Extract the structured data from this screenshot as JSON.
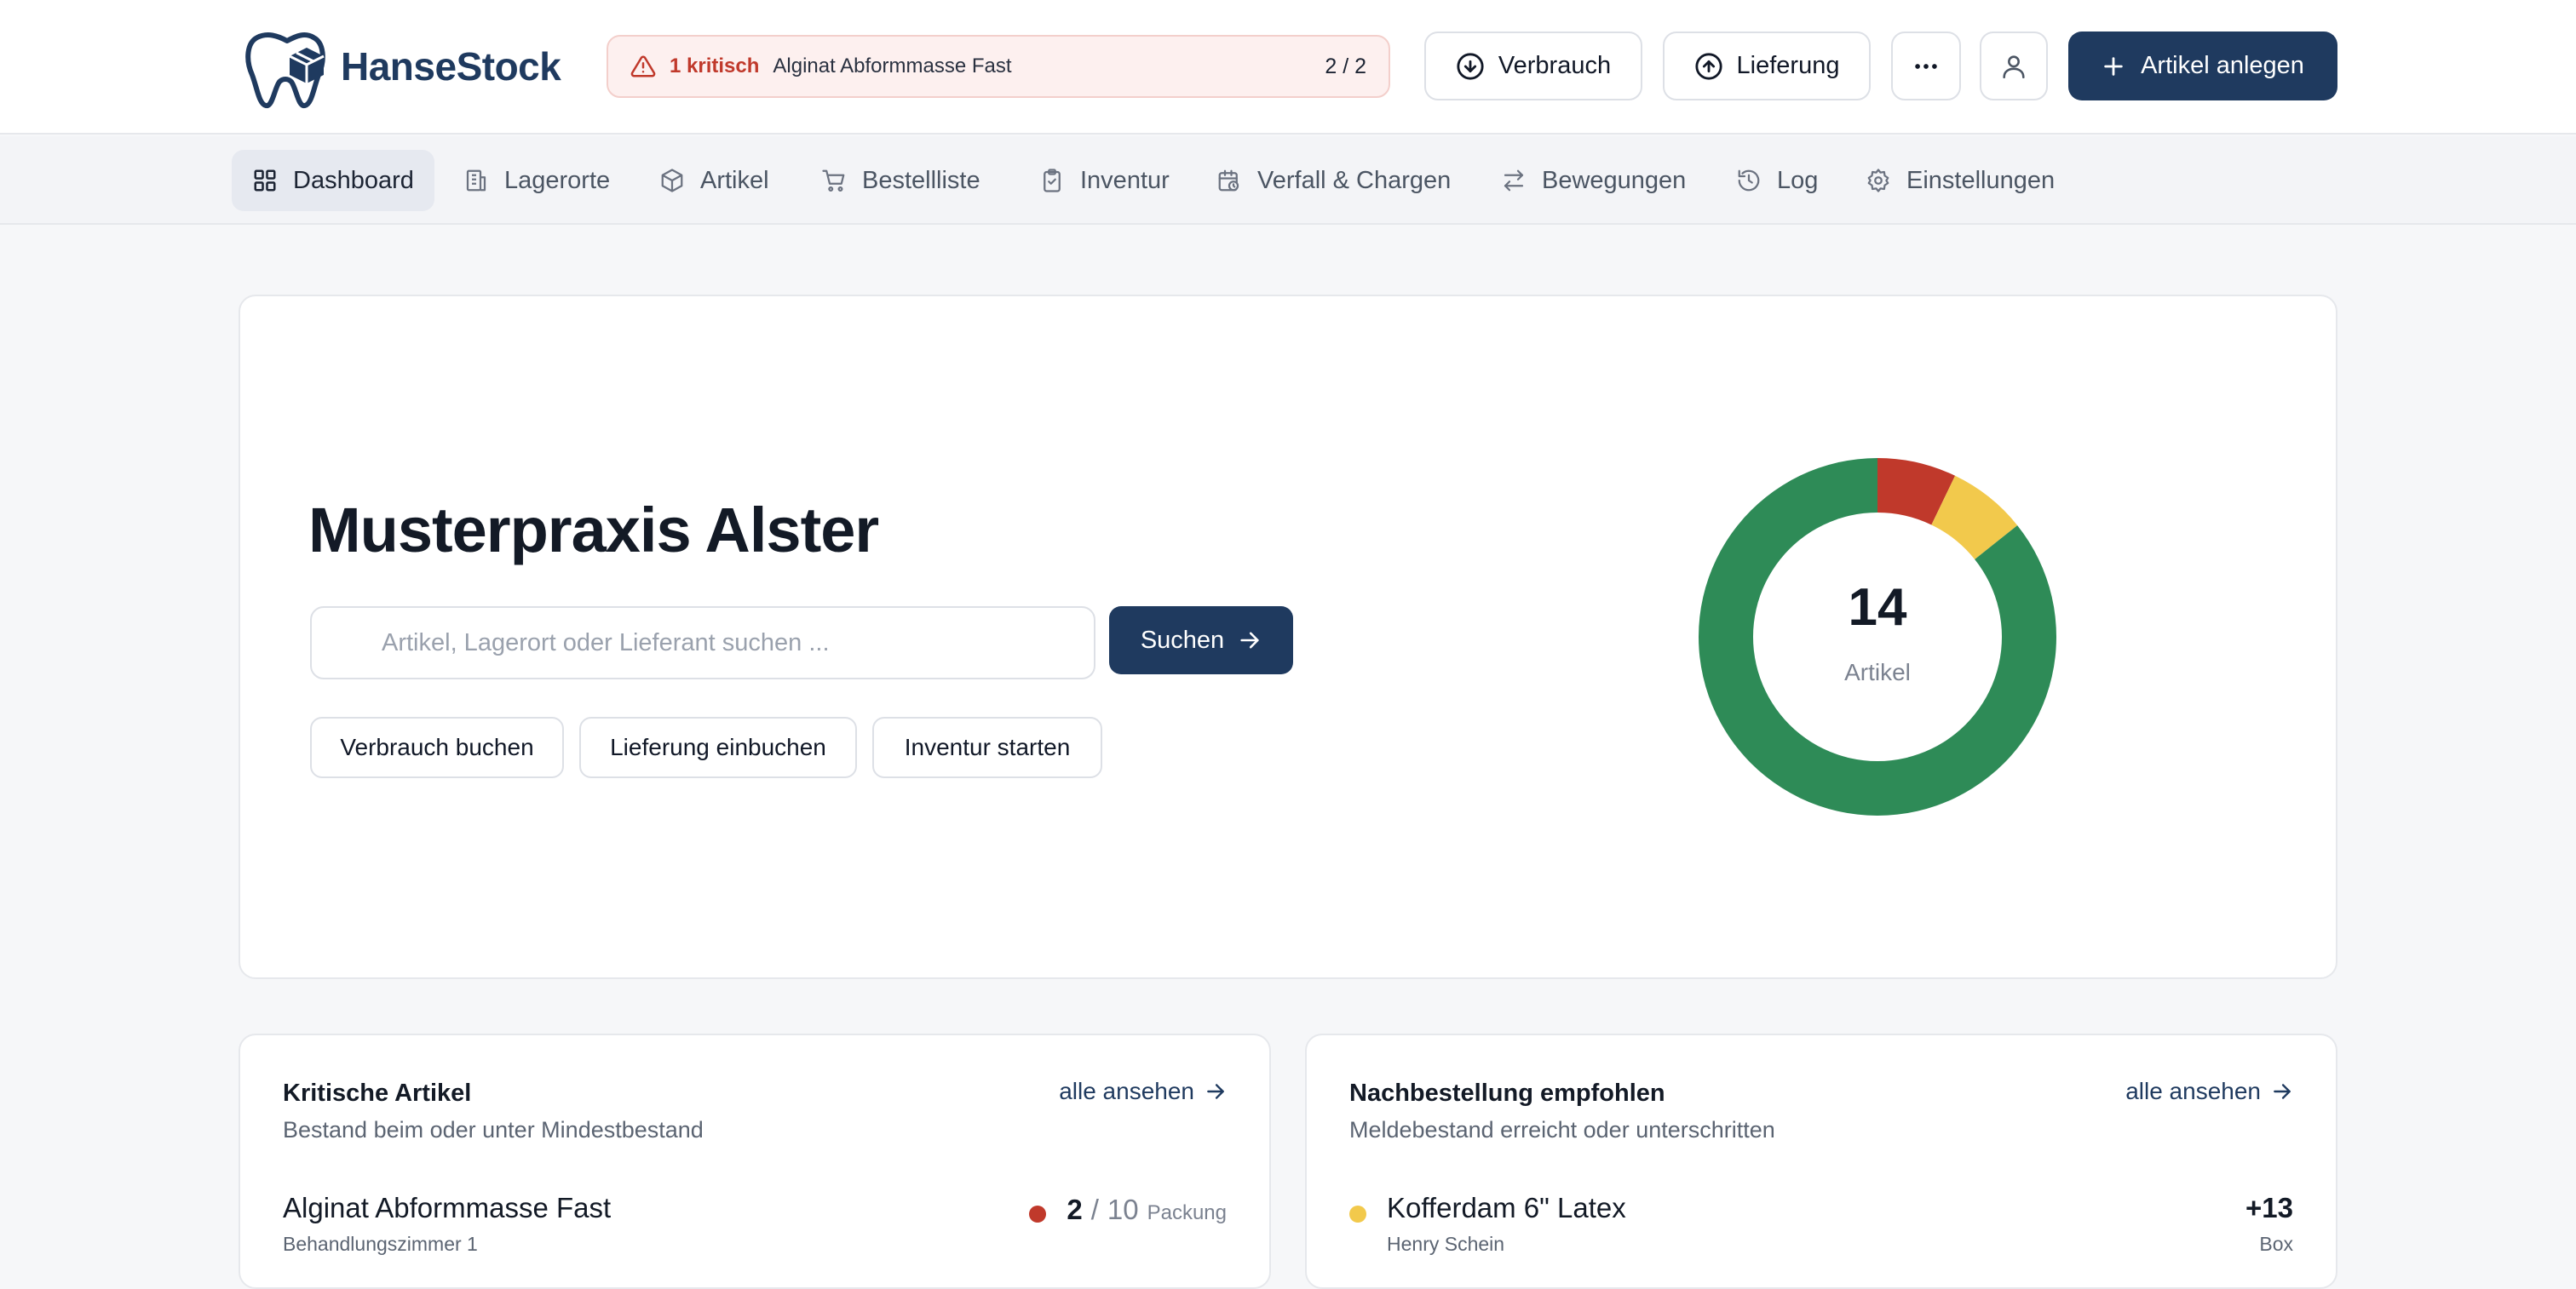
{
  "app": {
    "name": "HanseStock"
  },
  "alert": {
    "critical_label": "1 kritisch",
    "item": "Alginat Abformmasse Fast",
    "counter": "2 / 2"
  },
  "header": {
    "verbrauch_label": "Verbrauch",
    "lieferung_label": "Lieferung",
    "more_icon": "more-horizontal-icon",
    "user_icon": "user-icon",
    "new_article_label": "Artikel anlegen"
  },
  "nav": {
    "items": [
      {
        "label": "Dashboard",
        "icon": "grid-icon",
        "active": true
      },
      {
        "label": "Lagerorte",
        "icon": "building-icon"
      },
      {
        "label": "Artikel",
        "icon": "box-icon"
      },
      {
        "label": "Bestellliste",
        "icon": "cart-icon"
      },
      {
        "label": "Inventur",
        "icon": "clipboard-icon"
      },
      {
        "label": "Verfall & Chargen",
        "icon": "calendar-clock-icon"
      },
      {
        "label": "Bewegungen",
        "icon": "arrows-swap-icon"
      },
      {
        "label": "Log",
        "icon": "history-icon"
      },
      {
        "label": "Einstellungen",
        "icon": "gear-icon"
      }
    ]
  },
  "hero": {
    "title": "Musterpraxis Alster",
    "search_placeholder": "Artikel, Lagerort oder Lieferant suchen ...",
    "search_button": "Suchen",
    "quick_actions": [
      "Verbrauch buchen",
      "Lieferung einbuchen",
      "Inventur starten"
    ]
  },
  "chart_data": {
    "type": "pie",
    "style": "donut",
    "total": "14",
    "center_label": "Artikel",
    "slices": [
      {
        "value": 1,
        "color": "#c0392b"
      },
      {
        "value": 1,
        "color": "#f2c94c"
      },
      {
        "value": 12,
        "color": "#2e8b57"
      }
    ]
  },
  "critical": {
    "title": "Kritische Artikel",
    "subtitle": "Bestand beim oder unter Mindestbestand",
    "link": "alle ansehen",
    "rows": [
      {
        "name": "Alginat Abformmasse Fast",
        "location": "Behandlungszimmer 1",
        "current": "2",
        "min": "10",
        "unit": "Packung",
        "status_color": "#c0392b"
      }
    ]
  },
  "reorder": {
    "title": "Nachbestellung empfohlen",
    "subtitle": "Meldebestand erreicht oder unterschritten",
    "link": "alle ansehen",
    "rows": [
      {
        "name": "Kofferdam 6\" Latex",
        "supplier": "Henry Schein",
        "delta": "+13",
        "unit": "Box",
        "status_color": "#f2c94c"
      }
    ]
  }
}
